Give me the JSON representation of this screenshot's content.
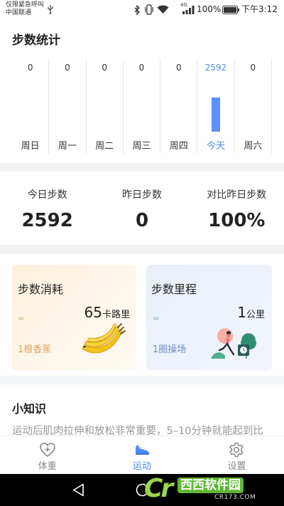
{
  "status_bar": {
    "carrier_line1": "仅限紧急呼叫",
    "carrier_line2": "中国联通",
    "signal_type": "4G",
    "battery": "100%",
    "time": "下午3:12",
    "icons": [
      "usb-icon",
      "bluetooth-icon",
      "vibrate-icon",
      "wifi-icon",
      "signal-icon",
      "battery-icon"
    ]
  },
  "steps_chart": {
    "title": "步数统计",
    "days": [
      {
        "label": "周日",
        "value": 0
      },
      {
        "label": "周一",
        "value": 0
      },
      {
        "label": "周二",
        "value": 0
      },
      {
        "label": "周三",
        "value": 0
      },
      {
        "label": "周四",
        "value": 0
      },
      {
        "label": "今天",
        "value": 2592,
        "today": true
      },
      {
        "label": "周六",
        "value": 0
      }
    ]
  },
  "stats": [
    {
      "label": "今日步数",
      "value": "2592"
    },
    {
      "label": "昨日步数",
      "value": "0"
    },
    {
      "label": "对比昨日步数",
      "value": "100%"
    }
  ],
  "cards": {
    "calories": {
      "title": "步数消耗",
      "approx": "≈",
      "value": "65",
      "unit": "卡路里",
      "equivalent": "1根香蕉",
      "illustration": "banana"
    },
    "distance": {
      "title": "步数里程",
      "approx": "≈",
      "value": "1",
      "unit": "公里",
      "equivalent": "1圈操场",
      "illustration": "runner"
    }
  },
  "tips": {
    "title": "小知识",
    "text": "运动后肌肉拉伸和放松非常重要，5–10分钟就能起到比"
  },
  "bottom_nav": [
    {
      "label": "体重",
      "icon": "heart-plus-icon",
      "active": false
    },
    {
      "label": "运动",
      "icon": "sneaker-icon",
      "active": true
    },
    {
      "label": "设置",
      "icon": "gear-icon",
      "active": false
    }
  ],
  "system_nav": {
    "icons": [
      "back-icon",
      "home-icon"
    ]
  },
  "watermark": {
    "logo": "Cr",
    "name": "西西软件园",
    "site": "CR173.COM"
  },
  "colors": {
    "accent": "#4a8af4",
    "bar": "#5b8ff9",
    "calorie_equivalent": "#d9a35e",
    "distance_equivalent": "#6f8fc6",
    "separator": "#f2f3f5"
  }
}
